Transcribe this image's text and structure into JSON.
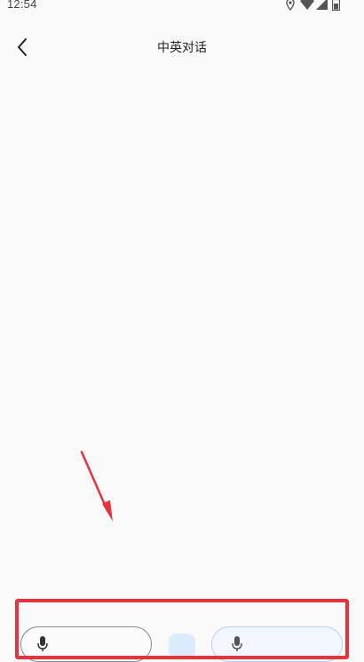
{
  "status_bar": {
    "time": "12:54",
    "icons": [
      "location-icon",
      "wifi-icon",
      "signal-icon",
      "battery-icon"
    ]
  },
  "app_bar": {
    "title": "中英对话",
    "back_icon": "chevron-left-icon"
  },
  "bottom": {
    "left_button_label": "",
    "right_button_label": "",
    "swap_icon": "swap-icon"
  },
  "colors": {
    "background": "#f9f9f9",
    "highlight": "#e8323c",
    "arrow": "#e8323c",
    "right_button_border": "#b7d3ee",
    "swap_bg": "#dcebfb"
  }
}
